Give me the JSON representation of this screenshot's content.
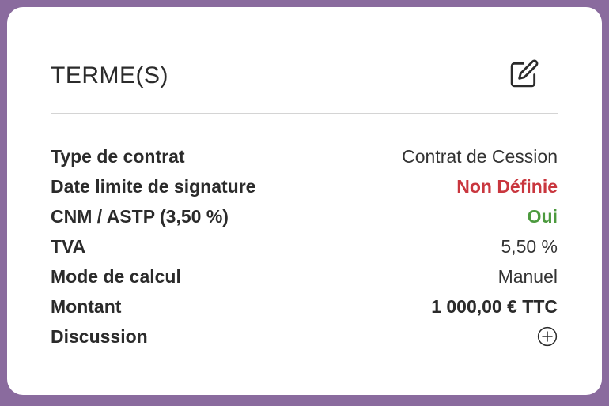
{
  "card": {
    "title": "TERME(S)",
    "edit_icon": "edit-icon"
  },
  "rows": [
    {
      "label": "Type de contrat",
      "value": "Contrat de Cession",
      "style": "normal"
    },
    {
      "label": "Date limite de signature",
      "value": "Non Définie",
      "style": "red",
      "color": "#c9363e"
    },
    {
      "label": "CNM / ASTP (3,50 %)",
      "value": "Oui",
      "style": "green",
      "color": "#4c9a3e"
    },
    {
      "label": "TVA",
      "value": "5,50 %",
      "style": "normal"
    },
    {
      "label": "Mode de calcul",
      "value": "Manuel",
      "style": "normal"
    },
    {
      "label": "Montant",
      "value": "1 000,00 € TTC",
      "style": "bold"
    },
    {
      "label": "Discussion",
      "icon": "plus-circle-icon"
    }
  ],
  "colors": {
    "background": "#8a6b9e",
    "card": "#ffffff",
    "text": "#2b2b2b",
    "danger": "#c9363e",
    "success": "#4c9a3e"
  }
}
